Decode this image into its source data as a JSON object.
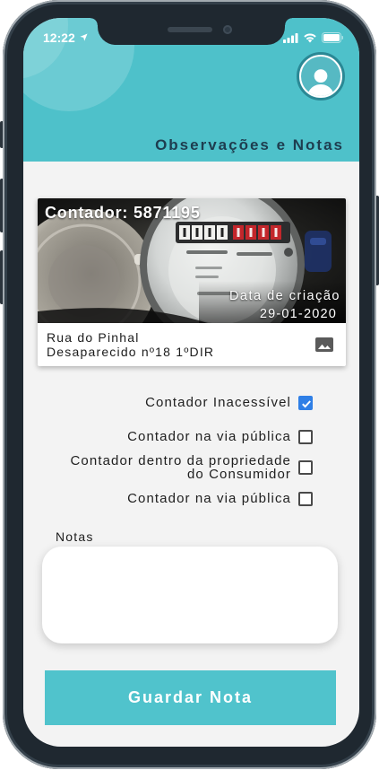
{
  "status_bar": {
    "time": "12:22",
    "icons": [
      "location-arrow-icon",
      "cellular-signal-icon",
      "wifi-icon",
      "battery-icon"
    ]
  },
  "header": {
    "title": "Observações e Notas",
    "avatar_icon": "user-avatar-icon"
  },
  "meter_card": {
    "counter": "Contador: 5871195",
    "creation_label": "Data de criação",
    "creation_date": "29-01-2020",
    "street": "Rua do Pinhal",
    "address_detail": "Desaparecido nº18 1ºDIR",
    "photo_icon": "image-icon"
  },
  "checklist": [
    {
      "lines": [
        "Contador Inacessível"
      ],
      "checked": true
    },
    {
      "lines": [
        "Contador na via pública"
      ],
      "checked": false
    },
    {
      "lines": [
        "Contador dentro da propriedade",
        "do Consumidor"
      ],
      "checked": false
    },
    {
      "lines": [
        "Contador na via pública"
      ],
      "checked": false
    }
  ],
  "notes": {
    "label": "Notas",
    "value": ""
  },
  "save_button": {
    "label": "Guardar Nota"
  },
  "colors": {
    "header_teal": "#4ec1ca",
    "button_teal": "#50c3cc",
    "title": "#1e3d4f",
    "checkbox_checked": "#2f7fe6",
    "background": "#f3f3f3"
  }
}
